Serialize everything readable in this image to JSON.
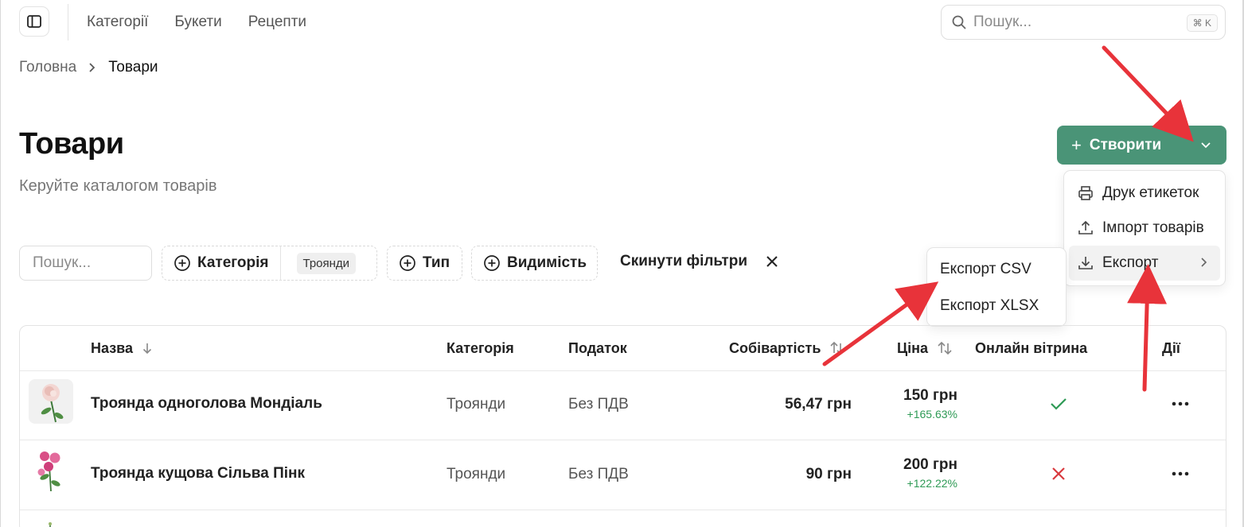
{
  "topbar": {
    "nav": [
      "Категорії",
      "Букети",
      "Рецепти"
    ],
    "search_placeholder": "Пошук...",
    "shortcut": "⌘ K"
  },
  "breadcrumb": {
    "home": "Головна",
    "current": "Товари"
  },
  "page": {
    "title": "Товари",
    "subtitle": "Керуйте каталогом товарів"
  },
  "create": {
    "label": "Створити",
    "menu": [
      {
        "label": "Друк етикеток",
        "icon": "printer-icon"
      },
      {
        "label": "Імпорт товарів",
        "icon": "upload-icon"
      },
      {
        "label": "Експорт",
        "icon": "download-icon"
      }
    ],
    "submenu": [
      "Експорт CSV",
      "Експорт XLSX"
    ]
  },
  "filters": {
    "search_placeholder": "Пошук...",
    "category_label": "Категорія",
    "category_value": "Троянди",
    "type_label": "Тип",
    "visibility_label": "Видимість",
    "reset_label": "Скинути фільтри"
  },
  "table": {
    "columns": [
      "Назва",
      "Категорія",
      "Податок",
      "Собівартість",
      "Ціна",
      "Онлайн вітрина",
      "Дії"
    ],
    "rows": [
      {
        "name": "Троянда одноголова Мондіаль",
        "category": "Троянди",
        "tax": "Без ПДВ",
        "cost": "56,47 грн",
        "price": "150 грн",
        "markup": "+165.63%",
        "online": true
      },
      {
        "name": "Троянда кущова Сільва Пінк",
        "category": "Троянди",
        "tax": "Без ПДВ",
        "cost": "90 грн",
        "price": "200 грн",
        "markup": "+122.22%",
        "online": false
      }
    ]
  },
  "colors": {
    "primary": "#4a9477",
    "positive": "#2e9a55",
    "negative": "#d9393e",
    "annotation": "#e8333a"
  }
}
